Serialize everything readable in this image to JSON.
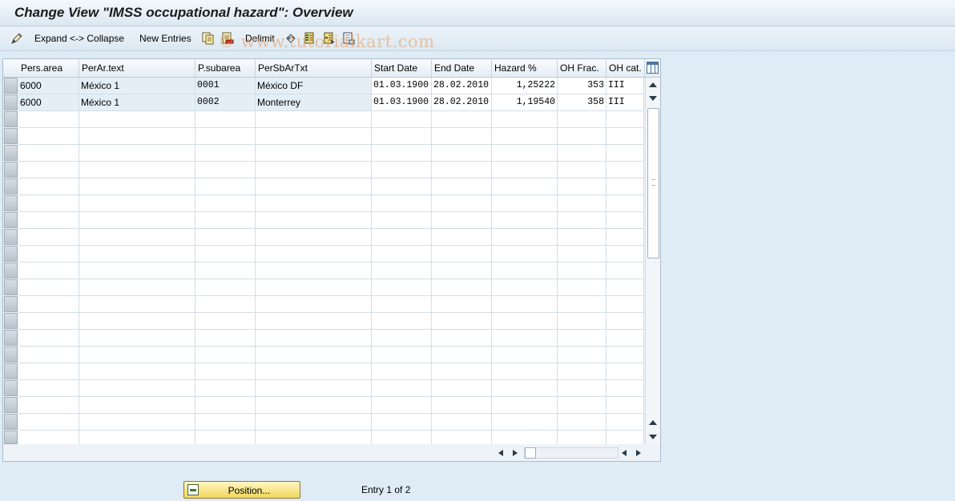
{
  "window": {
    "title": "Change View \"IMSS occupational hazard\": Overview"
  },
  "toolbar": {
    "expand_collapse_label": "Expand <-> Collapse",
    "new_entries_label": "New Entries",
    "delimit_label": "Delimit",
    "watermark": "© www.tutorialkart.com",
    "icons": [
      "display-change-icon",
      "copy-icon",
      "delete-icon",
      "undo-icon",
      "select-all-icon",
      "select-block-icon",
      "deselect-all-icon"
    ]
  },
  "table": {
    "columns": [
      "Pers.area",
      "PerAr.text",
      "P.subarea",
      "PerSbArTxt",
      "Start Date",
      "End Date",
      "Hazard %",
      "OH Frac.",
      "OH cat."
    ],
    "rows": [
      [
        "6000",
        "México 1",
        "0001",
        "México DF",
        "01.03.1900",
        "28.02.2010",
        "1,25222",
        "353",
        "III"
      ],
      [
        "6000",
        "México 1",
        "0002",
        "Monterrey",
        "01.03.1900",
        "28.02.2010",
        "1,19540",
        "358",
        "III"
      ]
    ]
  },
  "footer": {
    "position_button_label": "Position...",
    "entry_info": "Entry 1 of 2"
  },
  "colors": {
    "accent_button": "#f2d65a",
    "key_cell_bg": "#e4eef7",
    "background": "#dfebf5"
  }
}
